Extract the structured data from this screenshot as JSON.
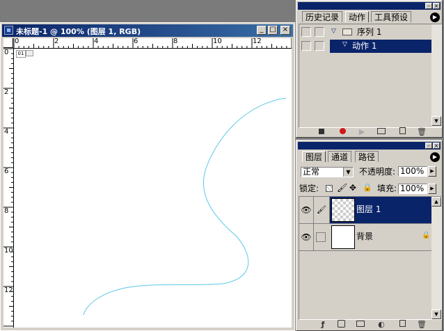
{
  "document": {
    "title": "未标题-1 @ 100% (图层 1, RGB)",
    "minimize": "_",
    "maximize": "□",
    "close": "×",
    "zoom_indicator": "01",
    "h_ruler_labels": [
      "0",
      "2",
      "4",
      "6",
      "8",
      "10",
      "12"
    ],
    "v_ruler_labels": [
      "0",
      "2",
      "4",
      "6",
      "8",
      "10",
      "12"
    ]
  },
  "history_panel": {
    "tabs": [
      "历史记录",
      "动作",
      "工具预设"
    ],
    "active_tab": "动作",
    "items": [
      {
        "label": "序列 1",
        "type": "folder"
      },
      {
        "label": "动作 1",
        "type": "action",
        "selected": true
      }
    ],
    "footer_icons": [
      "stop-icon",
      "record-icon",
      "play-icon",
      "new-set-icon",
      "new-action-icon",
      "delete-icon"
    ]
  },
  "layers_panel": {
    "tabs": [
      "图层",
      "通道",
      "路径"
    ],
    "active_tab": "图层",
    "blend_mode": "正常",
    "opacity_label": "不透明度:",
    "opacity_value": "100%",
    "lock_label": "锁定:",
    "fill_label": "填充:",
    "fill_value": "100%",
    "layers": [
      {
        "name": "图层 1",
        "selected": true,
        "visible": true,
        "transparent": true
      },
      {
        "name": "背景",
        "selected": false,
        "visible": true,
        "locked": true
      }
    ],
    "footer_icons": [
      "layer-style-icon",
      "mask-icon",
      "folder-icon",
      "adjustment-icon",
      "new-layer-icon",
      "delete-layer-icon"
    ]
  },
  "colors": {
    "title_bar": "#0a246a",
    "selection": "#0a246a",
    "stroke": "#5bc8e8",
    "record": "#d01818"
  }
}
